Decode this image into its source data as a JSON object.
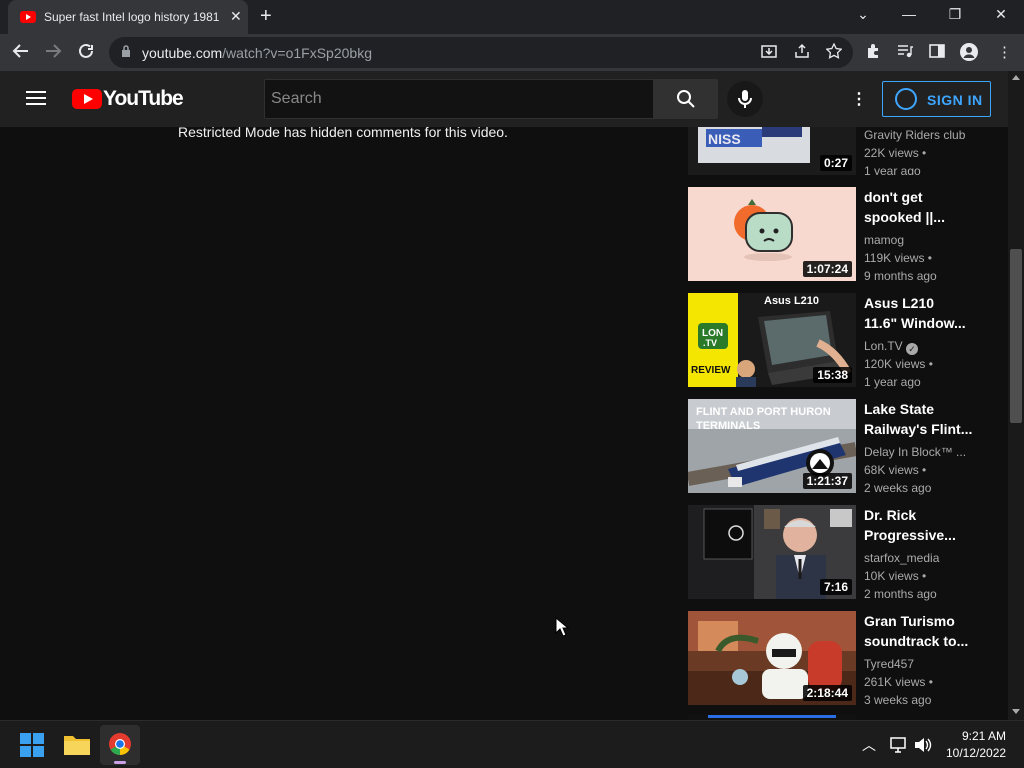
{
  "browser": {
    "tab_title": "Super fast Intel logo history 1981",
    "tab_close": "✕",
    "new_tab": "+",
    "url_domain": "youtube.com",
    "url_path": "/watch?v=o1FxSp20bkg",
    "window_controls": {
      "dropdown": "⌄",
      "minimize": "—",
      "restore": "❐",
      "close": "✕"
    }
  },
  "youtube": {
    "logo_text": "YouTube",
    "search_placeholder": "Search",
    "sign_in_label": "SIGN IN",
    "more_icon": "⋮"
  },
  "main": {
    "restricted_message": "Restricted Mode has hidden comments for this video."
  },
  "sidebar_videos": [
    {
      "title1": "",
      "title2": "",
      "channel": "Gravity Riders club",
      "views": "22K views •",
      "age": "1 year ago",
      "duration": "0:27"
    },
    {
      "title1": "don't get",
      "title2": "spooked ||...",
      "channel": "mamog",
      "views": "119K views •",
      "age": "9 months ago",
      "duration": "1:07:24"
    },
    {
      "title1": "Asus L210",
      "title2": "11.6\" Window...",
      "channel": "Lon.TV",
      "views": "120K views •",
      "age": "1 year ago",
      "duration": "15:38",
      "verified": true
    },
    {
      "title1": "Lake State",
      "title2": "Railway's Flint...",
      "channel": "Delay In Block™ ...",
      "views": "68K views •",
      "age": "2 weeks ago",
      "duration": "1:21:37"
    },
    {
      "title1": "Dr. Rick",
      "title2": "Progressive...",
      "channel": "starfox_media",
      "views": "10K views •",
      "age": "2 months ago",
      "duration": "7:16"
    },
    {
      "title1": "Gran Turismo",
      "title2": "soundtrack to...",
      "channel": "Tyred457",
      "views": "261K views •",
      "age": "3 weeks ago",
      "duration": "2:18:44"
    }
  ],
  "thumbnail_text": {
    "asus_title": "Asus L210",
    "lontv_line1": "LON",
    "lontv_line2": ".TV",
    "review": "REVIEW",
    "flint_line1": "FLINT AND PORT HURON",
    "flint_line2": "TERMINALS"
  },
  "taskbar": {
    "time": "9:21 AM",
    "date": "10/12/2022"
  },
  "colors": {
    "accent_blue": "#3ea6ff",
    "youtube_red": "#ff0000",
    "page_bg": "#0f0f0f"
  }
}
